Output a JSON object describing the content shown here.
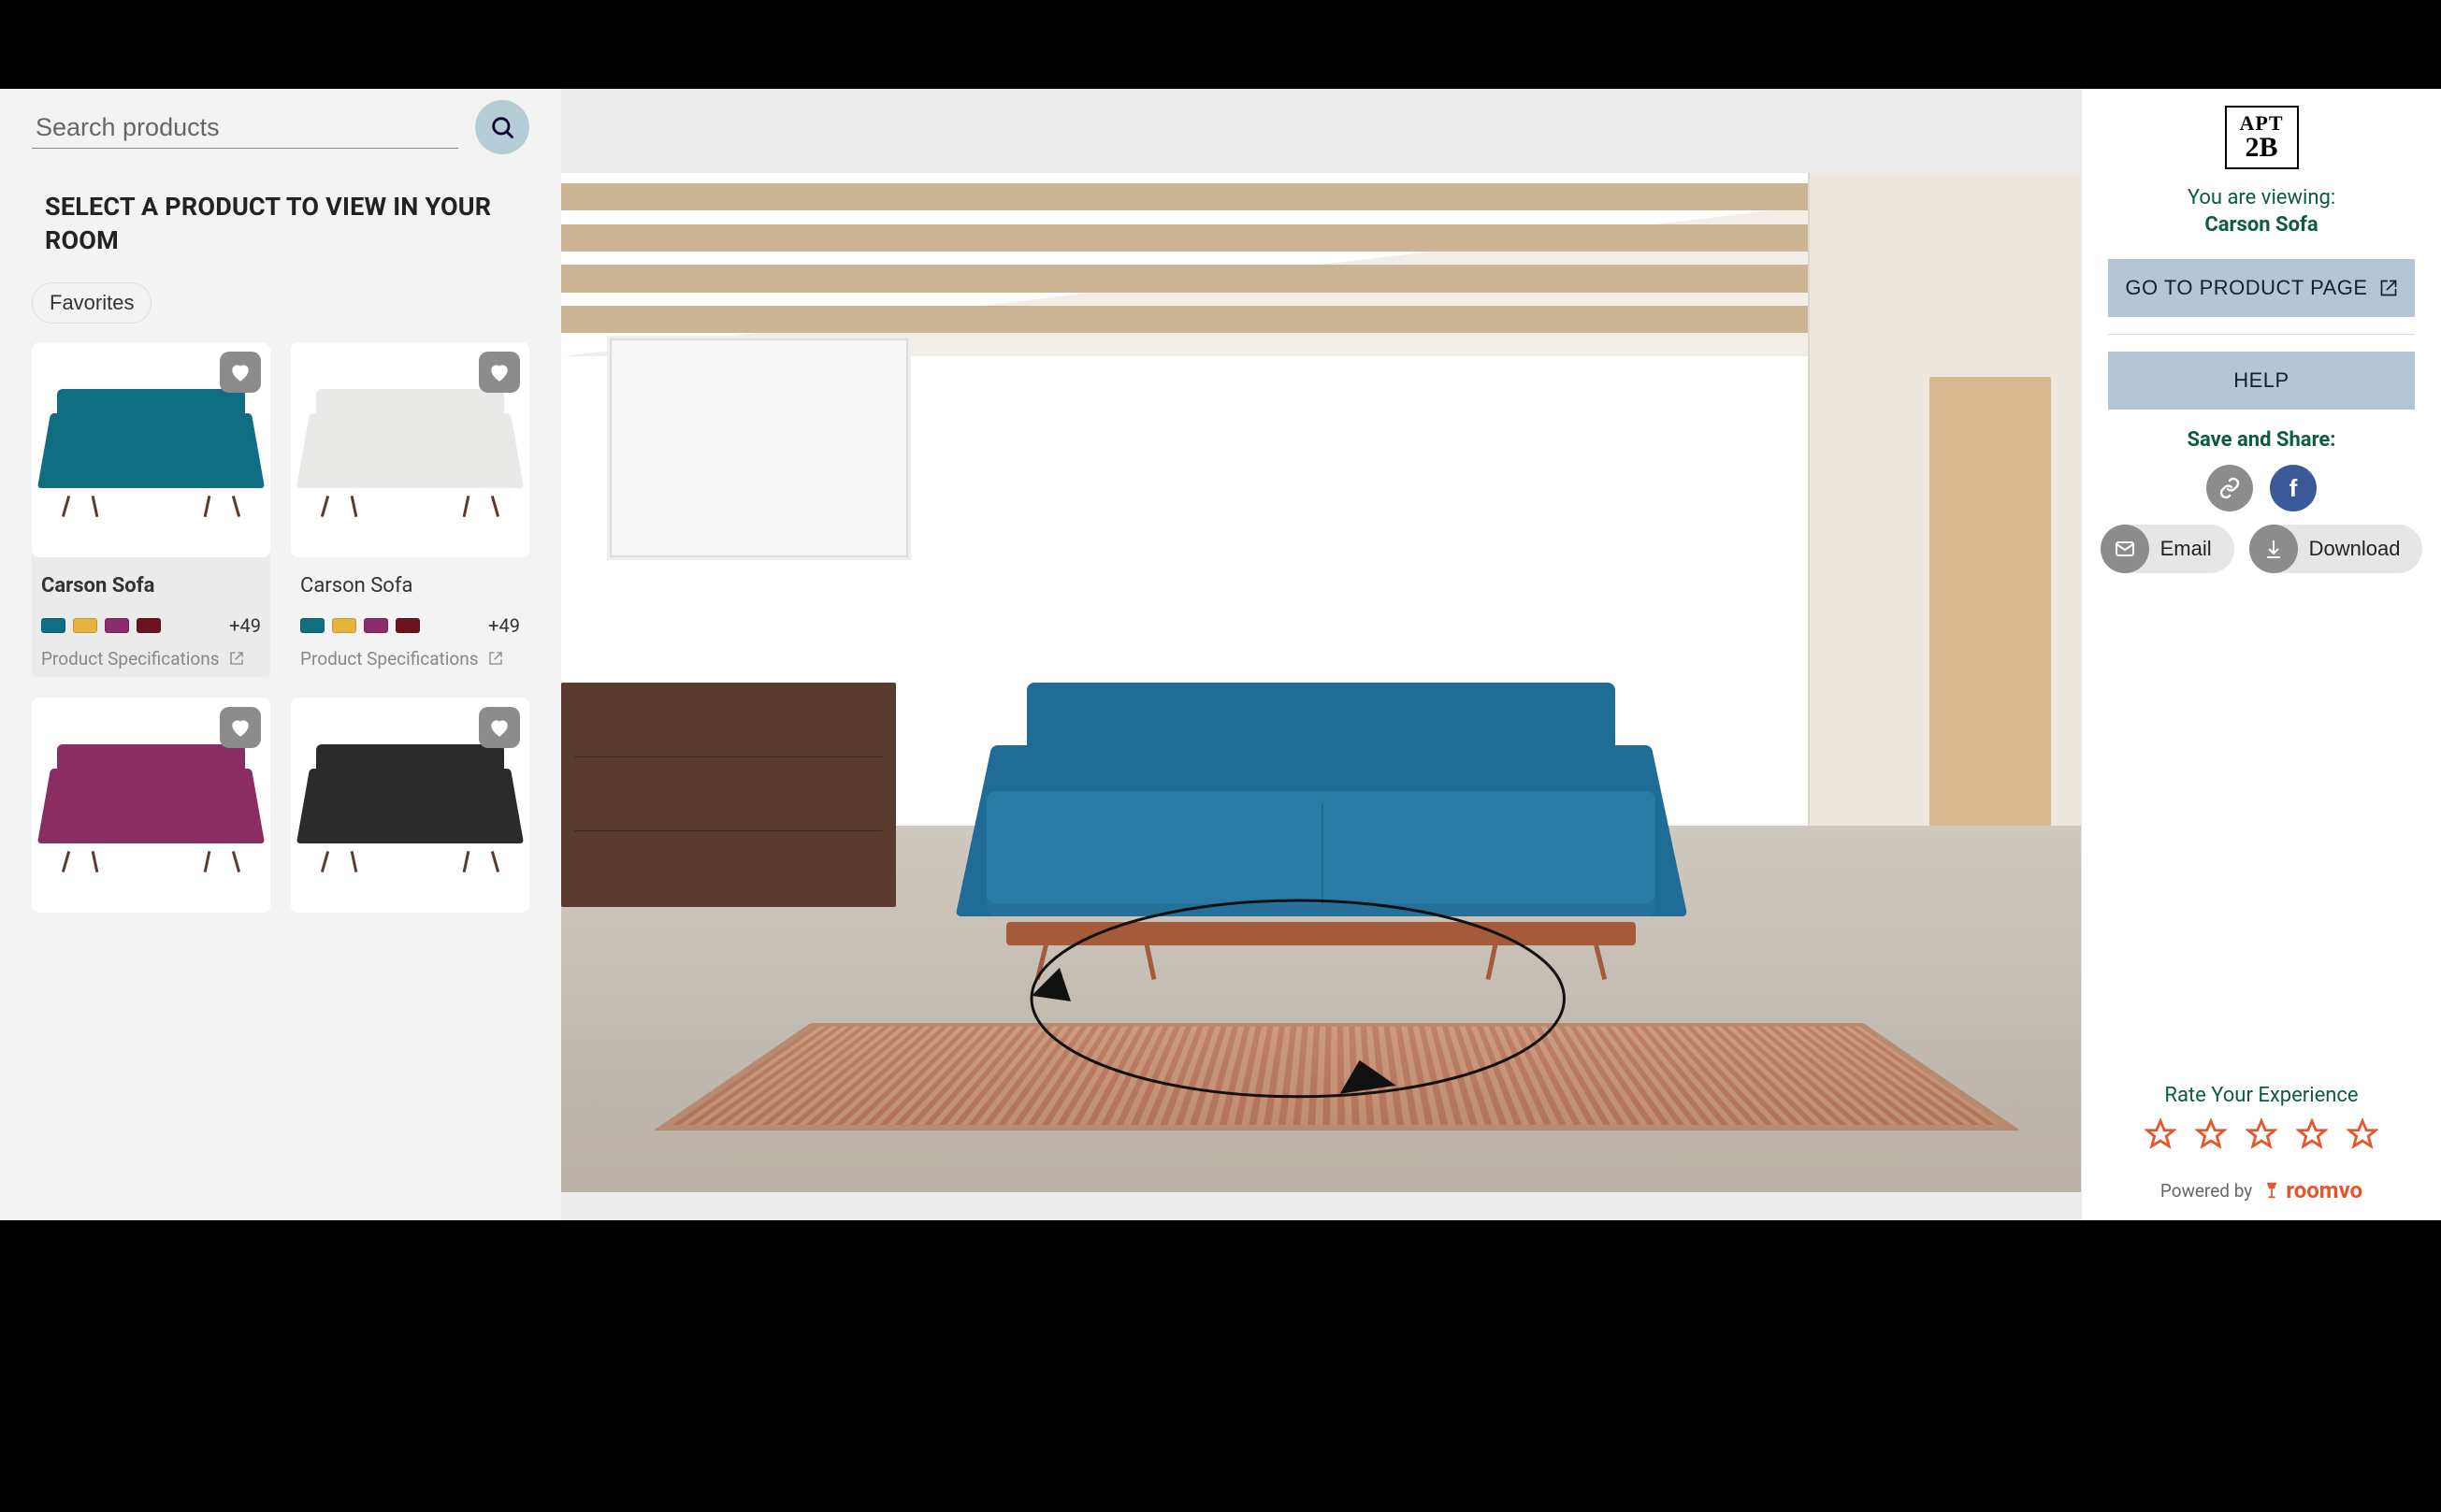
{
  "search": {
    "placeholder": "Search products"
  },
  "sidebar": {
    "title": "SELECT A PRODUCT TO VIEW IN YOUR ROOM",
    "filters": {
      "favorites": "Favorites"
    }
  },
  "products": [
    {
      "name": "Carson Sofa",
      "selected": true,
      "color": "#0f6e82",
      "swatches": [
        "#0f6e82",
        "#e6b33c",
        "#8c2d6b",
        "#6b1420"
      ],
      "more_swatches": "+49",
      "spec_label": "Product Specifications"
    },
    {
      "name": "Carson Sofa",
      "selected": false,
      "color": "#e9e9e7",
      "swatches": [
        "#0f6e82",
        "#e6b33c",
        "#8c2d6b",
        "#6b1420"
      ],
      "more_swatches": "+49",
      "spec_label": "Product Specifications"
    },
    {
      "name": "",
      "selected": false,
      "color": "#8a2d63"
    },
    {
      "name": "",
      "selected": false,
      "color": "#2b2b2b"
    }
  ],
  "panel": {
    "brand": {
      "line1": "APT",
      "line2": "2B"
    },
    "viewing_label": "You are viewing:",
    "viewing_name": "Carson Sofa",
    "product_page_btn": "GO TO PRODUCT PAGE",
    "help_btn": "HELP",
    "share_title": "Save and Share:",
    "email_label": "Email",
    "download_label": "Download",
    "rate_title": "Rate Your Experience",
    "powered_by": "Powered by",
    "roomvo": "roomvo"
  }
}
